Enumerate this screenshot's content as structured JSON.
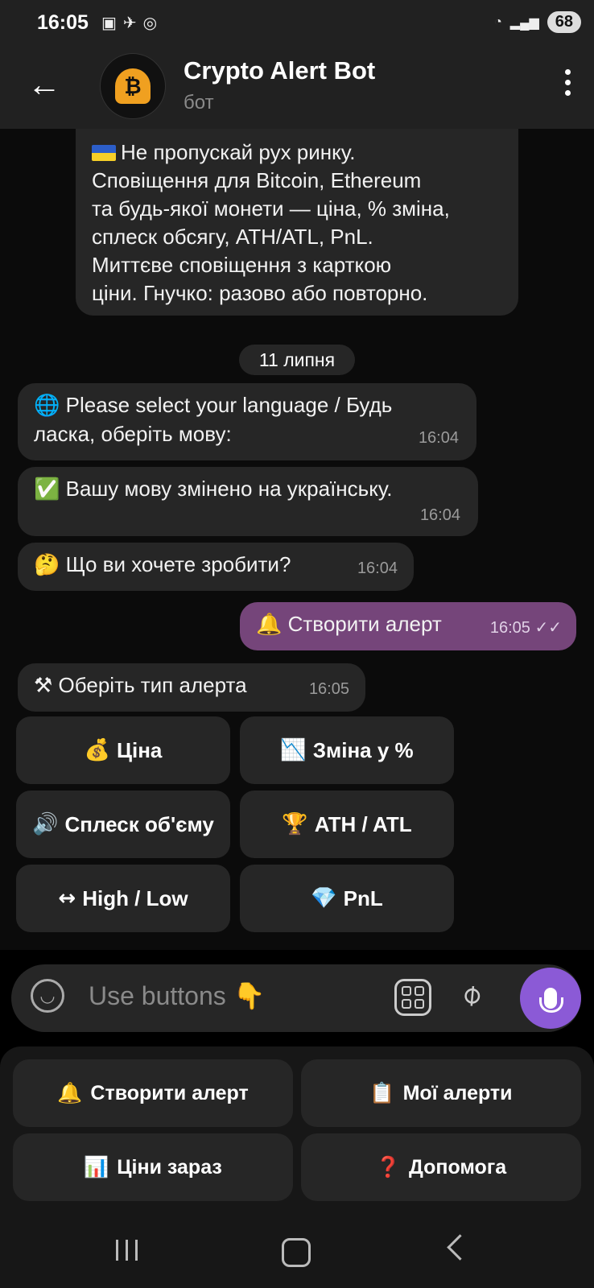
{
  "status_bar": {
    "time": "16:05",
    "battery": "68"
  },
  "header": {
    "title": "Crypto Alert Bot",
    "subtitle": "бот",
    "avatar_glyph": "₿"
  },
  "chat": {
    "intro_lines": [
      "Не пропускай рух ринку.",
      "Сповіщення для Bitcoin, Ethereum",
      "та будь-якої монети — ціна, % зміна,",
      "сплеск обсягу, ATH/ATL, PnL.",
      "Миттєве сповіщення з карткою",
      "ціни. Гнучко: разово або повторно."
    ],
    "date_separator": "11 липня",
    "messages": [
      {
        "emoji": "🌐",
        "text": "Please select your language / Будь",
        "text2": "ласка, оберіть мову:",
        "time": "16:04"
      },
      {
        "emoji": "✅",
        "text": "Вашу мову змінено на українську.",
        "time": "16:04"
      },
      {
        "emoji": "🤔",
        "text": "Що ви хочете зробити?",
        "time": "16:04"
      },
      {
        "emoji": "🔔",
        "text": "Створити алерт",
        "time": "16:05",
        "ticks": "✓✓"
      },
      {
        "emoji": "⚒",
        "text": "Оберіть тип алерта",
        "time": "16:05"
      }
    ]
  },
  "inline_keyboard": [
    {
      "icon": "💰",
      "label": "Ціна"
    },
    {
      "icon": "📉",
      "label": "Зміна у %"
    },
    {
      "icon": "🔊",
      "label": "Сплеск об'єму"
    },
    {
      "icon": "🏆",
      "label": "ATH / ATL"
    },
    {
      "icon": "↔",
      "label": "High / Low"
    },
    {
      "icon": "💎",
      "label": "PnL"
    }
  ],
  "input": {
    "placeholder": "Use buttons 👇"
  },
  "reply_keyboard": [
    {
      "icon": "🔔",
      "label": "Створити алерт"
    },
    {
      "icon": "📋",
      "label": "Мої алерти"
    },
    {
      "icon": "📊",
      "label": "Ціни зараз"
    },
    {
      "icon": "❓",
      "label": "Допомога"
    }
  ],
  "colors": {
    "outgoing_bubble": "#75457a",
    "mic_button": "#8b5ad6",
    "bubble": "#262626"
  }
}
